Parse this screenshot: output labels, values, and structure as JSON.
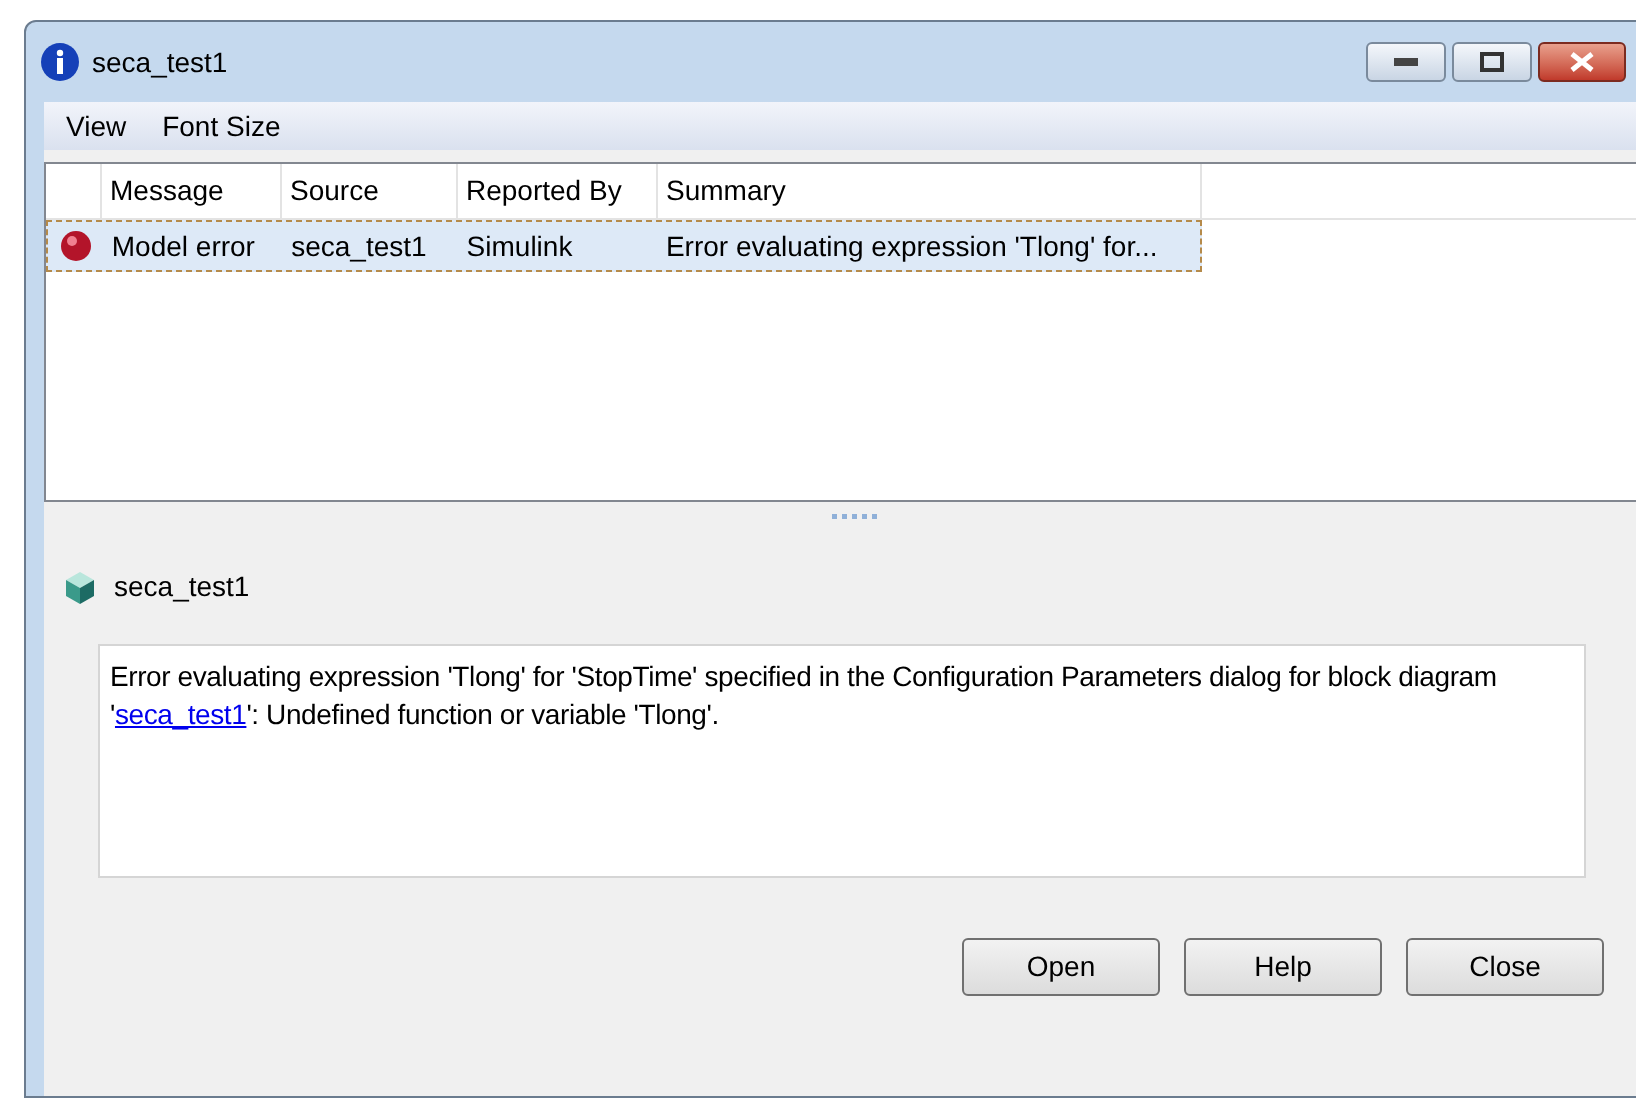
{
  "window": {
    "title": "seca_test1"
  },
  "menu": [
    "View",
    "Font Size"
  ],
  "table": {
    "columns": [
      "Message",
      "Source",
      "Reported By",
      "Summary"
    ],
    "rows": [
      {
        "cells": [
          "Model error",
          "seca_test1",
          "Simulink",
          "Error evaluating expression 'Tlong' for..."
        ],
        "selected": true
      }
    ]
  },
  "detail": {
    "title": "seca_test1",
    "message_before": "Error evaluating expression 'Tlong' for 'StopTime' specified in the Configuration Parameters dialog for block diagram '",
    "link": "seca_test1",
    "message_after": "': Undefined function or variable 'Tlong'."
  },
  "buttons": [
    "Open",
    "Help",
    "Close"
  ]
}
